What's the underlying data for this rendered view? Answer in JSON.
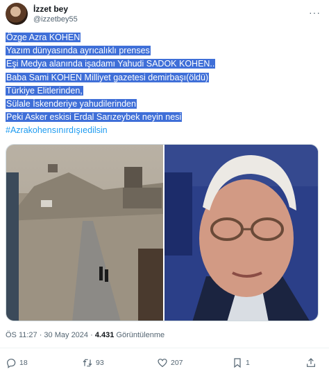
{
  "author": {
    "name": "İzzet bey",
    "handle": "@izzetbey55"
  },
  "more_label": "···",
  "tweet_lines": [
    "Özge Azra KOHEN",
    "Yazım dünyasında ayrıcalıklı prenses",
    "Eşi Medya alanında işadamı Yahudi SADOK KOHEN..",
    "Baba Sami KOHEN Milliyet gazetesi demirbaşı(öldü)",
    "Türkiye Elitlerinden,",
    "Sülale İskenderiye yahudilerinden",
    "Peki Asker eskisi Erdal Sarızeybek neyin nesi"
  ],
  "hashtag": "#Azrakohensınırdışıedilsin",
  "meta": {
    "time": "ÖS 11:27 · 30 May 2024 · ",
    "views_count": "4.431",
    "views_label": " Görüntülenme"
  },
  "actions": {
    "replies": "18",
    "reposts": "93",
    "likes": "207",
    "bookmarks": "1"
  },
  "colors": {
    "selection": "#3f6fd8",
    "link": "#1d9bf0",
    "muted": "#536471"
  }
}
